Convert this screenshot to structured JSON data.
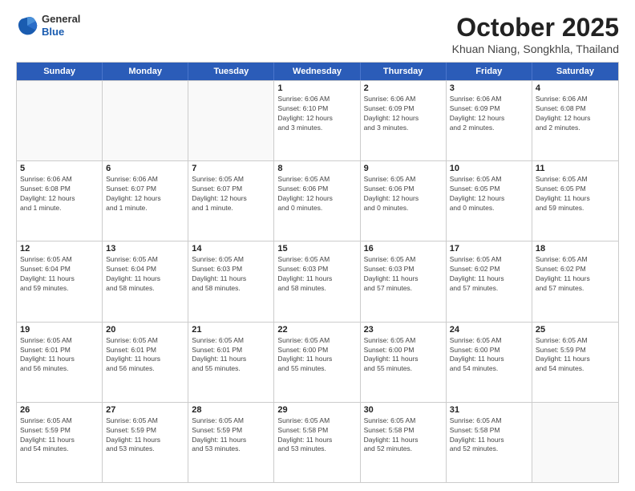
{
  "logo": {
    "general": "General",
    "blue": "Blue"
  },
  "header": {
    "month": "October 2025",
    "location": "Khuan Niang, Songkhla, Thailand"
  },
  "weekdays": [
    "Sunday",
    "Monday",
    "Tuesday",
    "Wednesday",
    "Thursday",
    "Friday",
    "Saturday"
  ],
  "rows": [
    [
      {
        "day": "",
        "info": ""
      },
      {
        "day": "",
        "info": ""
      },
      {
        "day": "",
        "info": ""
      },
      {
        "day": "1",
        "info": "Sunrise: 6:06 AM\nSunset: 6:10 PM\nDaylight: 12 hours\nand 3 minutes."
      },
      {
        "day": "2",
        "info": "Sunrise: 6:06 AM\nSunset: 6:09 PM\nDaylight: 12 hours\nand 3 minutes."
      },
      {
        "day": "3",
        "info": "Sunrise: 6:06 AM\nSunset: 6:09 PM\nDaylight: 12 hours\nand 2 minutes."
      },
      {
        "day": "4",
        "info": "Sunrise: 6:06 AM\nSunset: 6:08 PM\nDaylight: 12 hours\nand 2 minutes."
      }
    ],
    [
      {
        "day": "5",
        "info": "Sunrise: 6:06 AM\nSunset: 6:08 PM\nDaylight: 12 hours\nand 1 minute."
      },
      {
        "day": "6",
        "info": "Sunrise: 6:06 AM\nSunset: 6:07 PM\nDaylight: 12 hours\nand 1 minute."
      },
      {
        "day": "7",
        "info": "Sunrise: 6:05 AM\nSunset: 6:07 PM\nDaylight: 12 hours\nand 1 minute."
      },
      {
        "day": "8",
        "info": "Sunrise: 6:05 AM\nSunset: 6:06 PM\nDaylight: 12 hours\nand 0 minutes."
      },
      {
        "day": "9",
        "info": "Sunrise: 6:05 AM\nSunset: 6:06 PM\nDaylight: 12 hours\nand 0 minutes."
      },
      {
        "day": "10",
        "info": "Sunrise: 6:05 AM\nSunset: 6:05 PM\nDaylight: 12 hours\nand 0 minutes."
      },
      {
        "day": "11",
        "info": "Sunrise: 6:05 AM\nSunset: 6:05 PM\nDaylight: 11 hours\nand 59 minutes."
      }
    ],
    [
      {
        "day": "12",
        "info": "Sunrise: 6:05 AM\nSunset: 6:04 PM\nDaylight: 11 hours\nand 59 minutes."
      },
      {
        "day": "13",
        "info": "Sunrise: 6:05 AM\nSunset: 6:04 PM\nDaylight: 11 hours\nand 58 minutes."
      },
      {
        "day": "14",
        "info": "Sunrise: 6:05 AM\nSunset: 6:03 PM\nDaylight: 11 hours\nand 58 minutes."
      },
      {
        "day": "15",
        "info": "Sunrise: 6:05 AM\nSunset: 6:03 PM\nDaylight: 11 hours\nand 58 minutes."
      },
      {
        "day": "16",
        "info": "Sunrise: 6:05 AM\nSunset: 6:03 PM\nDaylight: 11 hours\nand 57 minutes."
      },
      {
        "day": "17",
        "info": "Sunrise: 6:05 AM\nSunset: 6:02 PM\nDaylight: 11 hours\nand 57 minutes."
      },
      {
        "day": "18",
        "info": "Sunrise: 6:05 AM\nSunset: 6:02 PM\nDaylight: 11 hours\nand 57 minutes."
      }
    ],
    [
      {
        "day": "19",
        "info": "Sunrise: 6:05 AM\nSunset: 6:01 PM\nDaylight: 11 hours\nand 56 minutes."
      },
      {
        "day": "20",
        "info": "Sunrise: 6:05 AM\nSunset: 6:01 PM\nDaylight: 11 hours\nand 56 minutes."
      },
      {
        "day": "21",
        "info": "Sunrise: 6:05 AM\nSunset: 6:01 PM\nDaylight: 11 hours\nand 55 minutes."
      },
      {
        "day": "22",
        "info": "Sunrise: 6:05 AM\nSunset: 6:00 PM\nDaylight: 11 hours\nand 55 minutes."
      },
      {
        "day": "23",
        "info": "Sunrise: 6:05 AM\nSunset: 6:00 PM\nDaylight: 11 hours\nand 55 minutes."
      },
      {
        "day": "24",
        "info": "Sunrise: 6:05 AM\nSunset: 6:00 PM\nDaylight: 11 hours\nand 54 minutes."
      },
      {
        "day": "25",
        "info": "Sunrise: 6:05 AM\nSunset: 5:59 PM\nDaylight: 11 hours\nand 54 minutes."
      }
    ],
    [
      {
        "day": "26",
        "info": "Sunrise: 6:05 AM\nSunset: 5:59 PM\nDaylight: 11 hours\nand 54 minutes."
      },
      {
        "day": "27",
        "info": "Sunrise: 6:05 AM\nSunset: 5:59 PM\nDaylight: 11 hours\nand 53 minutes."
      },
      {
        "day": "28",
        "info": "Sunrise: 6:05 AM\nSunset: 5:59 PM\nDaylight: 11 hours\nand 53 minutes."
      },
      {
        "day": "29",
        "info": "Sunrise: 6:05 AM\nSunset: 5:58 PM\nDaylight: 11 hours\nand 53 minutes."
      },
      {
        "day": "30",
        "info": "Sunrise: 6:05 AM\nSunset: 5:58 PM\nDaylight: 11 hours\nand 52 minutes."
      },
      {
        "day": "31",
        "info": "Sunrise: 6:05 AM\nSunset: 5:58 PM\nDaylight: 11 hours\nand 52 minutes."
      },
      {
        "day": "",
        "info": ""
      }
    ]
  ]
}
